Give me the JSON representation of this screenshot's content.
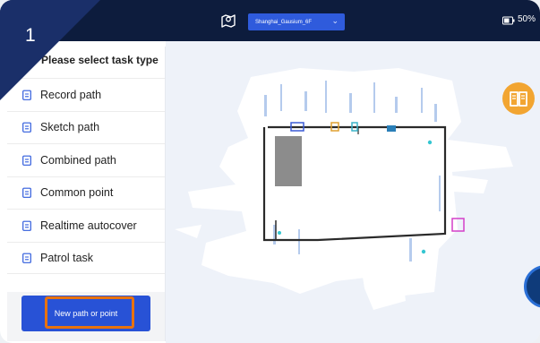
{
  "step": {
    "number": "1"
  },
  "topbar": {
    "map_icon": "map-pin-icon",
    "map_name": "Shanghai_Gausium_6F",
    "dropdown_icon": "chevron-down-icon",
    "battery_icon": "battery-icon",
    "battery_text": "50%"
  },
  "panel": {
    "title": "Please select task type",
    "tasks": [
      {
        "label": "Record path",
        "icon": "task-icon"
      },
      {
        "label": "Sketch path",
        "icon": "task-icon"
      },
      {
        "label": "Combined path",
        "icon": "task-icon"
      },
      {
        "label": "Common point",
        "icon": "task-icon"
      },
      {
        "label": "Realtime autocover",
        "icon": "task-icon"
      },
      {
        "label": "Patrol task",
        "icon": "task-icon"
      }
    ],
    "new_button_label": "New path or point"
  },
  "map": {
    "book_icon": "book-icon",
    "action_icon": "action-fab-icon"
  },
  "colors": {
    "topbar": "#0d1c3d",
    "accent_blue": "#2852d6",
    "highlight_orange": "#e8720f",
    "book_orange": "#f2a531"
  }
}
